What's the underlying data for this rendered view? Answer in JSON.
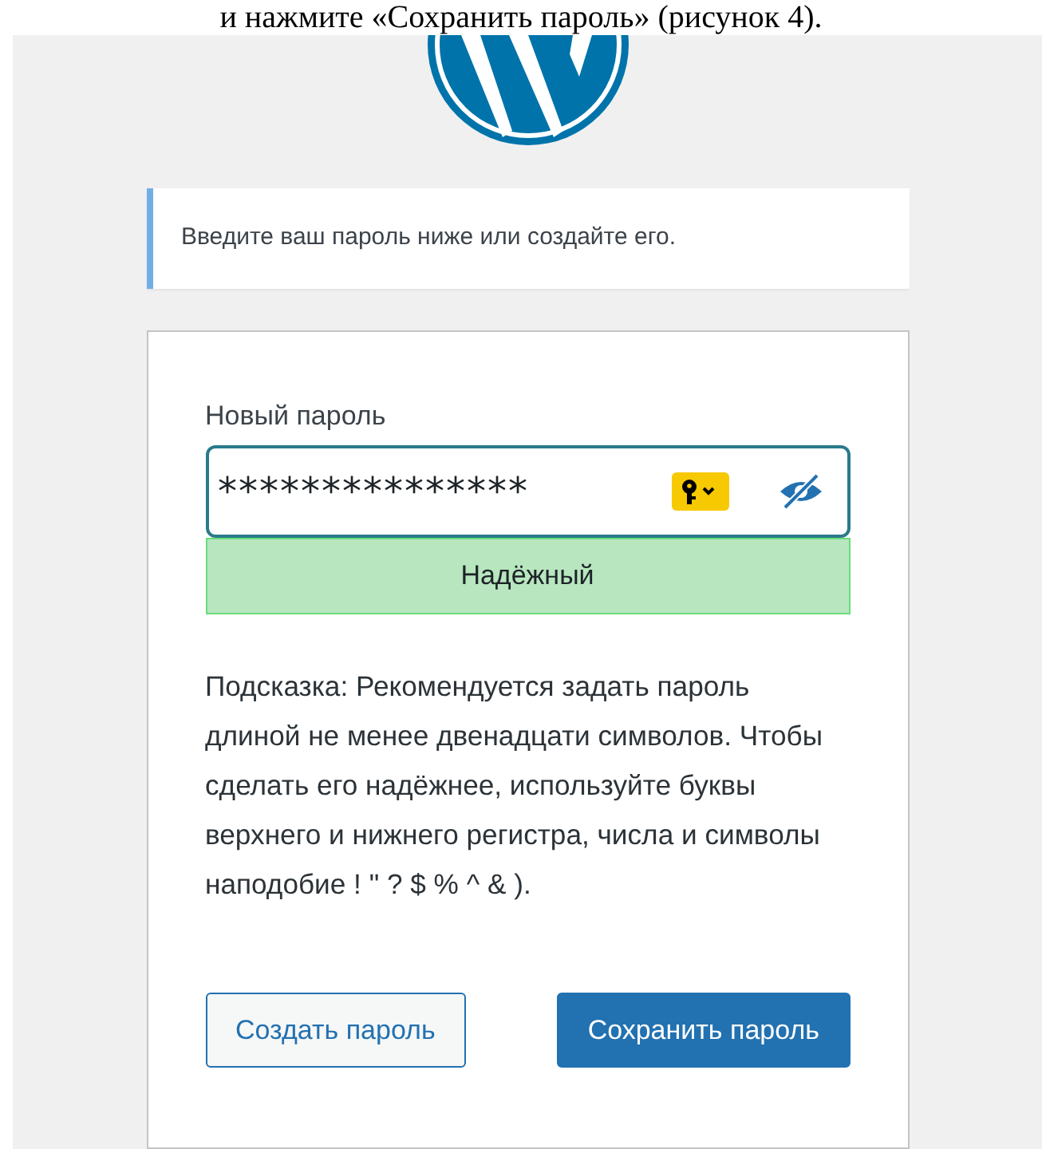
{
  "doc_text": "и нажмите «Сохранить пароль» (рисунок 4).",
  "notice": "Введите ваш пароль ниже или создайте его.",
  "form": {
    "label": "Новый пароль",
    "password": "***************",
    "strength": "Надёжный",
    "hint": "Подсказка: Рекомендуется задать пароль длиной не менее двенадцати символов. Чтобы сделать его надёжнее, используйте буквы верхнего и нижнего регистра, числа и символы наподобие ! \" ? $ % ^ & ).",
    "buttons": [
      {
        "label": "Создать пароль",
        "kind": "secondary"
      },
      {
        "label": "Сохранить пароль",
        "kind": "primary"
      }
    ]
  }
}
